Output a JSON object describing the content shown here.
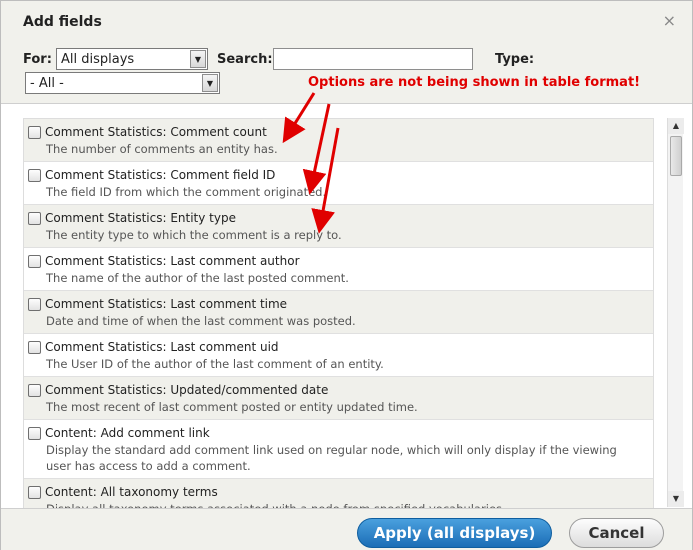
{
  "dialog": {
    "title": "Add fields",
    "close_glyph": "×",
    "close_icon": "close-icon"
  },
  "filters": {
    "for_label": "For:",
    "for_value": "All displays",
    "search_label": "Search:",
    "search_value": "",
    "type_label": "Type:",
    "type_value": "- All -"
  },
  "annotation": {
    "text": "Options are not being shown in table format!",
    "color": "#e00000"
  },
  "fields": [
    {
      "name": "Comment Statistics: Comment count",
      "description": "The number of comments an entity has."
    },
    {
      "name": "Comment Statistics: Comment field ID",
      "description": "The field ID from which the comment originated."
    },
    {
      "name": "Comment Statistics: Entity type",
      "description": "The entity type to which the comment is a reply to."
    },
    {
      "name": "Comment Statistics: Last comment author",
      "description": "The name of the author of the last posted comment."
    },
    {
      "name": "Comment Statistics: Last comment time",
      "description": "Date and time of when the last comment was posted."
    },
    {
      "name": "Comment Statistics: Last comment uid",
      "description": "The User ID of the author of the last comment of an entity."
    },
    {
      "name": "Comment Statistics: Updated/commented date",
      "description": "The most recent of last comment posted or entity updated time."
    },
    {
      "name": "Content: Add comment link",
      "description": "Display the standard add comment link used on regular node, which will only display if the viewing user has access to add a comment."
    },
    {
      "name": "Content: All taxonomy terms",
      "description": "Display all taxonomy terms associated with a node from specified vocabularies."
    }
  ],
  "buttons": {
    "apply": "Apply (all displays)",
    "cancel": "Cancel"
  },
  "colors": {
    "apply_button": "#1b6db6",
    "row_alt": "#f0f0eb"
  }
}
